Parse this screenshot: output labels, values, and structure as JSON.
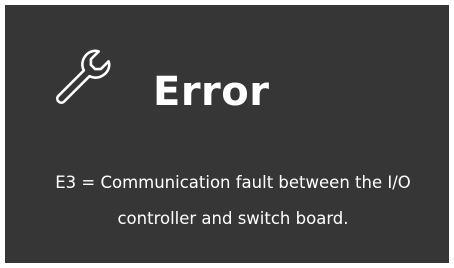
{
  "screen": {
    "background_color": "#363636",
    "text_color": "#ffffff",
    "icon": "wrench-icon",
    "title": "Error",
    "message_line1": "E3 = Communication fault between the I/O",
    "message_line2": "controller and switch board."
  }
}
